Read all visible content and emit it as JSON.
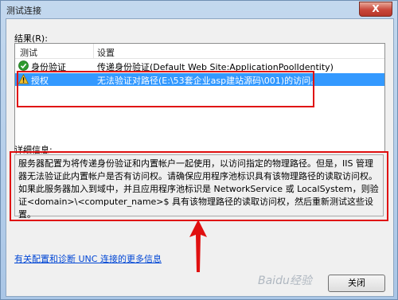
{
  "window": {
    "title": "测试连接",
    "close_glyph": "X"
  },
  "results": {
    "label": "结果(R):",
    "columns": [
      "测试",
      "设置"
    ],
    "rows": [
      {
        "status": "success",
        "icon": "check-icon",
        "test": "身份验证",
        "setting": "传递身份验证(Default Web Site:ApplicationPoolIdentity)"
      },
      {
        "status": "warning",
        "icon": "warning-icon",
        "test": "授权",
        "setting": "无法验证对路径(E:\\53套企业asp建站源码\\001)的访问。",
        "selected": true
      }
    ]
  },
  "details": {
    "label": "详细信息:",
    "text": "服务器配置为将传递身份验证和内置帐户一起使用，以访问指定的物理路径。但是，IIS 管理器无法验证此内置帐户是否有访问权。请确保应用程序池标识具有该物理路径的读取访问权。如果此服务器加入到域中，并且应用程序池标识是 NetworkService 或 LocalSystem，则验证<domain>\\<computer_name>$ 具有该物理路径的读取访问权，然后重新测试这些设置。"
  },
  "help_link": "有关配置和诊断 UNC 连接的更多信息",
  "buttons": {
    "close": "关闭"
  },
  "watermark": "Baidu经验",
  "colors": {
    "selection": "#3399ff",
    "annotation_red": "#e01010",
    "link": "#0046d5"
  }
}
